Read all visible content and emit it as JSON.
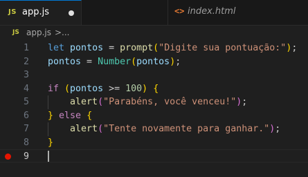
{
  "tabs": [
    {
      "icon": "JS",
      "label": "app.js",
      "dirty": true,
      "active": true
    },
    {
      "icon": "<>",
      "label": "index.html",
      "active": false
    }
  ],
  "breadcrumb": {
    "icon": "JS",
    "file": "app.js",
    "separator": ">",
    "more": "..."
  },
  "editor": {
    "language": "javascript",
    "breakpoint_color": "#e51400",
    "breakpoint_line": 9,
    "cursor_line": 9,
    "lines": [
      {
        "n": "1",
        "tokens": [
          {
            "t": "let",
            "c": "kw"
          },
          {
            "t": " ",
            "c": "plain"
          },
          {
            "t": "pontos",
            "c": "var"
          },
          {
            "t": " = ",
            "c": "plain"
          },
          {
            "t": "prompt",
            "c": "fn"
          },
          {
            "t": "(",
            "c": "p1"
          },
          {
            "t": "\"Digite sua pontuação:\"",
            "c": "str"
          },
          {
            "t": ")",
            "c": "p1"
          },
          {
            "t": ";",
            "c": "plain"
          }
        ]
      },
      {
        "n": "2",
        "tokens": [
          {
            "t": "pontos",
            "c": "var"
          },
          {
            "t": " = ",
            "c": "plain"
          },
          {
            "t": "Number",
            "c": "cls"
          },
          {
            "t": "(",
            "c": "p1"
          },
          {
            "t": "pontos",
            "c": "var"
          },
          {
            "t": ")",
            "c": "p1"
          },
          {
            "t": ";",
            "c": "plain"
          }
        ]
      },
      {
        "n": "3",
        "tokens": []
      },
      {
        "n": "4",
        "tokens": [
          {
            "t": "if",
            "c": "ctl"
          },
          {
            "t": " ",
            "c": "plain"
          },
          {
            "t": "(",
            "c": "p1"
          },
          {
            "t": "pontos",
            "c": "var"
          },
          {
            "t": " >= ",
            "c": "plain"
          },
          {
            "t": "100",
            "c": "num"
          },
          {
            "t": ")",
            "c": "p1"
          },
          {
            "t": " ",
            "c": "plain"
          },
          {
            "t": "{",
            "c": "p1"
          }
        ]
      },
      {
        "n": "5",
        "tokens": [
          {
            "t": "    ",
            "c": "plain"
          },
          {
            "t": "alert",
            "c": "fn"
          },
          {
            "t": "(",
            "c": "p2"
          },
          {
            "t": "\"Parabéns, você venceu!\"",
            "c": "str"
          },
          {
            "t": ")",
            "c": "p2"
          },
          {
            "t": ";",
            "c": "plain"
          }
        ]
      },
      {
        "n": "6",
        "tokens": [
          {
            "t": "}",
            "c": "p1"
          },
          {
            "t": " ",
            "c": "plain"
          },
          {
            "t": "else",
            "c": "ctl"
          },
          {
            "t": " ",
            "c": "plain"
          },
          {
            "t": "{",
            "c": "p1"
          }
        ]
      },
      {
        "n": "7",
        "tokens": [
          {
            "t": "    ",
            "c": "plain"
          },
          {
            "t": "alert",
            "c": "fn"
          },
          {
            "t": "(",
            "c": "p2"
          },
          {
            "t": "\"Tente novamente para ganhar.\"",
            "c": "str"
          },
          {
            "t": ")",
            "c": "p2"
          },
          {
            "t": ";",
            "c": "plain"
          }
        ]
      },
      {
        "n": "8",
        "tokens": [
          {
            "t": "}",
            "c": "p1"
          }
        ]
      },
      {
        "n": "9",
        "tokens": []
      }
    ]
  }
}
